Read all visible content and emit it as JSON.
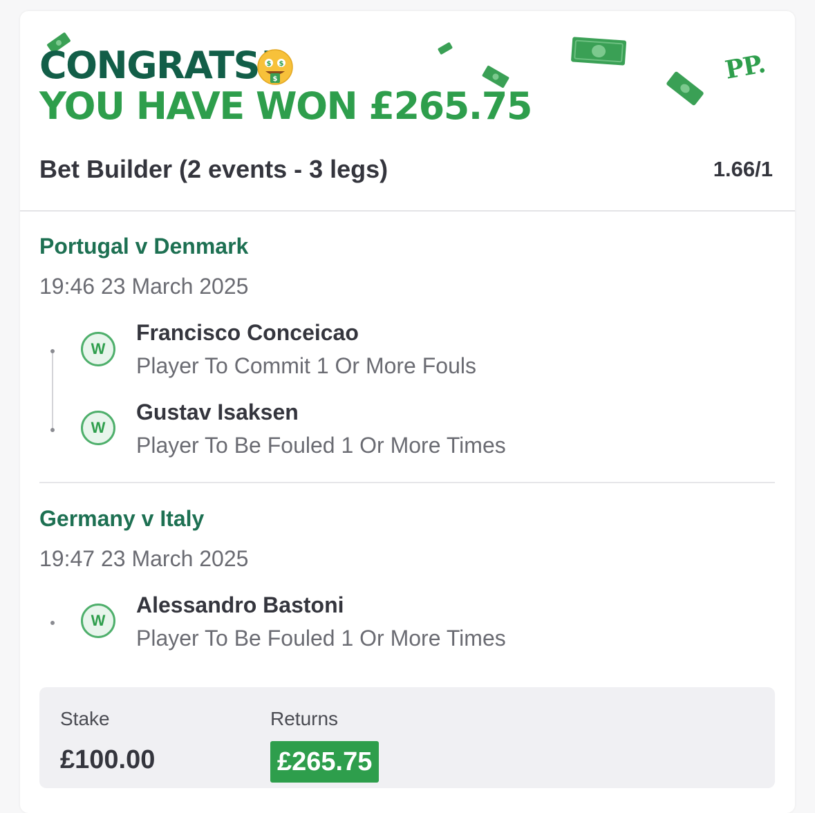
{
  "colors": {
    "brand_dark_green": "#125e48",
    "brand_green": "#2e9e4c",
    "event_title_green": "#1d7052",
    "text_dark": "#34353d",
    "text_muted": "#6a6b72",
    "summary_bg": "#f0f0f3"
  },
  "header": {
    "congrats": "CONGRATS!",
    "emoji_icon": "money-mouth-face-icon",
    "won_text": "YOU HAVE WON £265.75",
    "logo": "PP.",
    "bet_title": "Bet Builder (2 events - 3 legs)",
    "odds": "1.66/1"
  },
  "events": [
    {
      "title": "Portugal v Denmark",
      "time": "19:46 23 March 2025",
      "legs": [
        {
          "result": "W",
          "player": "Francisco Conceicao",
          "market": "Player To Commit 1 Or More Fouls"
        },
        {
          "result": "W",
          "player": "Gustav Isaksen",
          "market": "Player To Be Fouled 1 Or More Times"
        }
      ]
    },
    {
      "title": "Germany v Italy",
      "time": "19:47 23 March 2025",
      "legs": [
        {
          "result": "W",
          "player": "Alessandro Bastoni",
          "market": "Player To Be Fouled 1 Or More Times"
        }
      ]
    }
  ],
  "summary": {
    "stake_label": "Stake",
    "stake_value": "£100.00",
    "returns_label": "Returns",
    "returns_value": "£265.75"
  }
}
